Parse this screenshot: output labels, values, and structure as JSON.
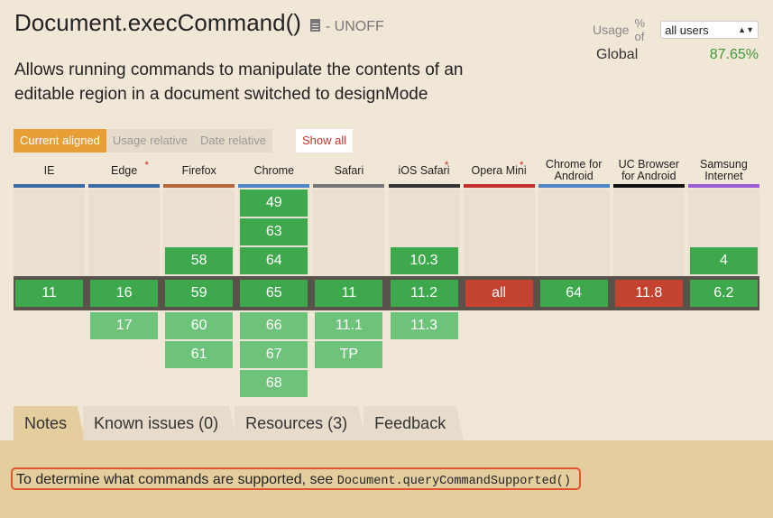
{
  "feature": {
    "title": "Document.execCommand()",
    "doc_icon": "document-icon",
    "status": "- UNOFF",
    "description": "Allows running commands to manipulate the contents of an editable region in a document switched to designMode"
  },
  "usage": {
    "label": "Usage",
    "pct_of": "% of",
    "selected": "all users",
    "global_label": "Global",
    "global_value": "87.65%",
    "global_color": "#3f9a3a"
  },
  "view_tabs": {
    "current": "Current aligned",
    "relative": "Usage relative",
    "date": "Date relative",
    "show_all": "Show all"
  },
  "colors": {
    "supported": "#3ea84c",
    "unsupported": "#c44230",
    "future": "#6ec37a",
    "accent": "#e99e38"
  },
  "browsers": [
    {
      "name": "IE",
      "bar": "#3b6aa8",
      "star": false,
      "past": [],
      "current": "11",
      "future": []
    },
    {
      "name": "Edge",
      "bar": "#3b6aa8",
      "star": true,
      "past": [],
      "current": "16",
      "future": [
        "17"
      ]
    },
    {
      "name": "Firefox",
      "bar": "#b5683a",
      "star": false,
      "past": [
        "58"
      ],
      "current": "59",
      "future": [
        "60",
        "61"
      ]
    },
    {
      "name": "Chrome",
      "bar": "#4e86c5",
      "star": false,
      "past": [
        "49",
        "63",
        "64"
      ],
      "current": "65",
      "future": [
        "66",
        "67",
        "68"
      ]
    },
    {
      "name": "Safari",
      "bar": "#777777",
      "star": false,
      "past": [],
      "current": "11",
      "future": [
        "11.1",
        "TP"
      ]
    },
    {
      "name": "iOS Safari",
      "bar": "#333333",
      "star": true,
      "past": [
        "10.3"
      ],
      "current": "11.2",
      "future": [
        "11.3"
      ]
    },
    {
      "name": "Opera Mini",
      "bar": "#c4302b",
      "star": true,
      "past": [],
      "current": "all",
      "current_unsupported": true,
      "future": []
    },
    {
      "name": "Chrome for Android",
      "bar": "#4e86c5",
      "star": false,
      "past": [],
      "current": "64",
      "future": []
    },
    {
      "name": "UC Browser for Android",
      "bar": "#111111",
      "star": false,
      "past": [],
      "current": "11.8",
      "current_unsupported": true,
      "future": []
    },
    {
      "name": "Samsung Internet",
      "bar": "#9d5bd6",
      "star": false,
      "past": [
        "4"
      ],
      "current": "6.2",
      "future": []
    }
  ],
  "tabs": [
    "Notes",
    "Known issues (0)",
    "Resources (3)",
    "Feedback"
  ],
  "note": {
    "text": "To determine what commands are supported, see ",
    "code": "Document.queryCommandSupported()"
  }
}
